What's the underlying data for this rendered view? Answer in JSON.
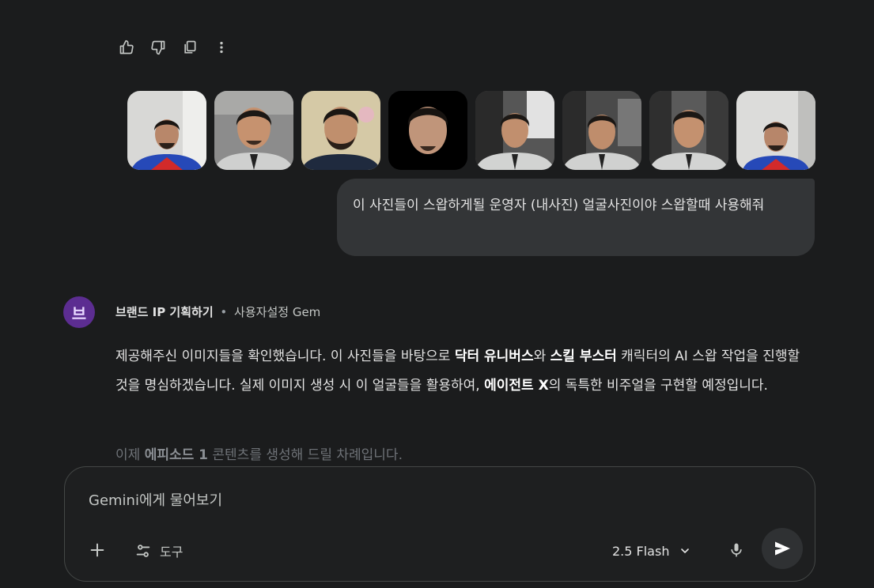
{
  "actions": {
    "items": [
      "thumbs-up-icon",
      "thumbs-down-icon",
      "copy-icon",
      "more-vert-icon"
    ]
  },
  "thumbnails_count": 8,
  "user_message": {
    "text": "이 사진들이 스왑하게될 운영자 (내사진) 얼굴사진이야 스왑할때 사용해줘"
  },
  "gem": {
    "avatar_letter": "브",
    "name": "브랜드 IP 기획하기",
    "separator": "•",
    "label": "사용자설정 Gem"
  },
  "response": {
    "p1_a": "제공해주신 이미지들을 확인했습니다. 이 사진들을 바탕으로 ",
    "p1_b1": "닥터 유니버스",
    "p1_c": "와 ",
    "p1_b2": "스킬 부스터",
    "p1_d": " 캐릭터의 AI 스왑 작업을 진행할 것을 명심하겠습니다. 실제 이미지 생성 시 이 얼굴들을 활용하여, ",
    "p1_b3": "에이전트 X",
    "p1_e": "의 독특한 비주얼을 구현할 예정입니다.",
    "p2_a": "이제 ",
    "p2_b": "에피소드 1",
    "p2_c": " 콘텐츠를 생성해 드릴 차례입니다."
  },
  "composer": {
    "placeholder": "Gemini에게 물어보기",
    "tools_label": "도구",
    "model_label": "2.5 Flash"
  },
  "colors": {
    "background": "#1b1c1d",
    "bubble": "#333537",
    "avatar": "#5c2d91"
  }
}
